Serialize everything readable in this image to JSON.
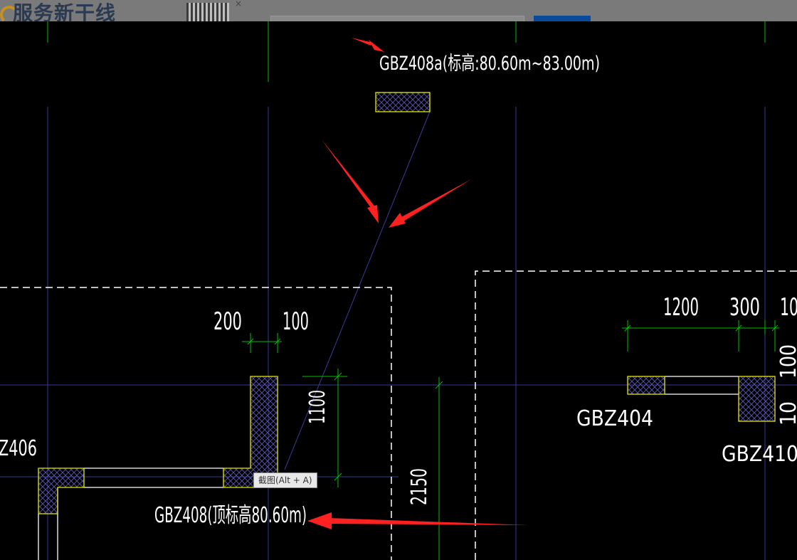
{
  "header": {
    "brand_text": "服务新干线",
    "close_glyph": "×"
  },
  "drawing": {
    "labels": {
      "gbz408a": "GBZ408a(标高:80.60m~83.00m)",
      "gbz408": "GBZ408(顶标高80.60m)",
      "gbz404": "GBZ404",
      "gbz406": "Z406",
      "gbz410": "GBZ410"
    },
    "dimensions": {
      "d200": "200",
      "d100_top": "100",
      "d1100": "1100",
      "d2150": "2150",
      "d1200": "1200",
      "d300": "300",
      "d10_edge": "10",
      "d100_right": "100",
      "d10_right": "10"
    },
    "colors": {
      "background": "#000000",
      "grid_line": "#00c000",
      "axis_line": "#3a3a9a",
      "column_outline": "#e6e600",
      "annotation_arrow": "#ff2020",
      "text": "#ffffff"
    }
  },
  "tooltip": {
    "text": "截图(Alt + A)"
  }
}
